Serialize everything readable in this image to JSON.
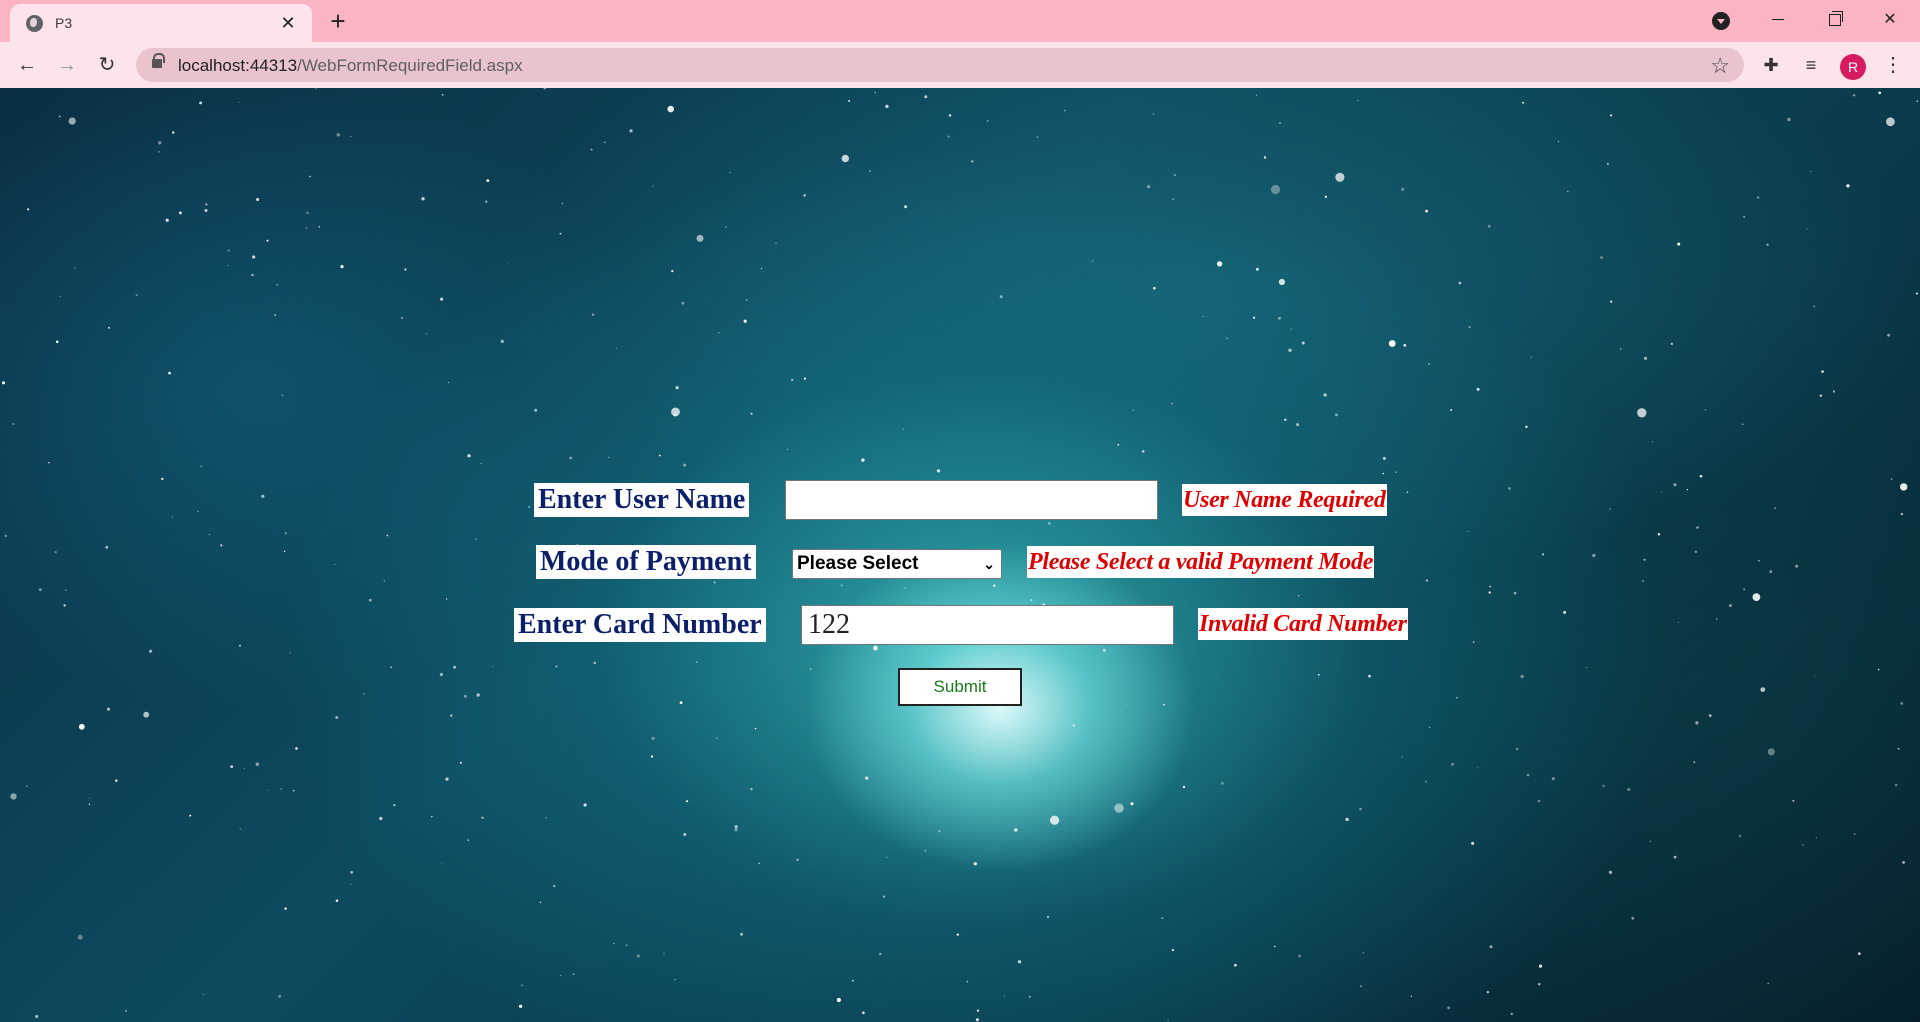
{
  "browser": {
    "tab_title": "P3",
    "url_host": "localhost:44313",
    "url_path": "/WebFormRequiredField.aspx",
    "profile_initial": "R"
  },
  "form": {
    "username_label": "Enter User Name",
    "username_value": "",
    "username_error": "User Name Required",
    "payment_label": "Mode of Payment",
    "payment_selected": "Please Select",
    "payment_error": "Please Select a valid Payment Mode",
    "card_label": "Enter Card Number",
    "card_value": "122",
    "card_error": "Invalid Card Number",
    "submit_label": "Submit"
  },
  "colors": {
    "label_text": "#0b1f6b",
    "error_text": "#e00000",
    "submit_text": "#1a7a1a",
    "tabbar": "#fbb4c4"
  }
}
